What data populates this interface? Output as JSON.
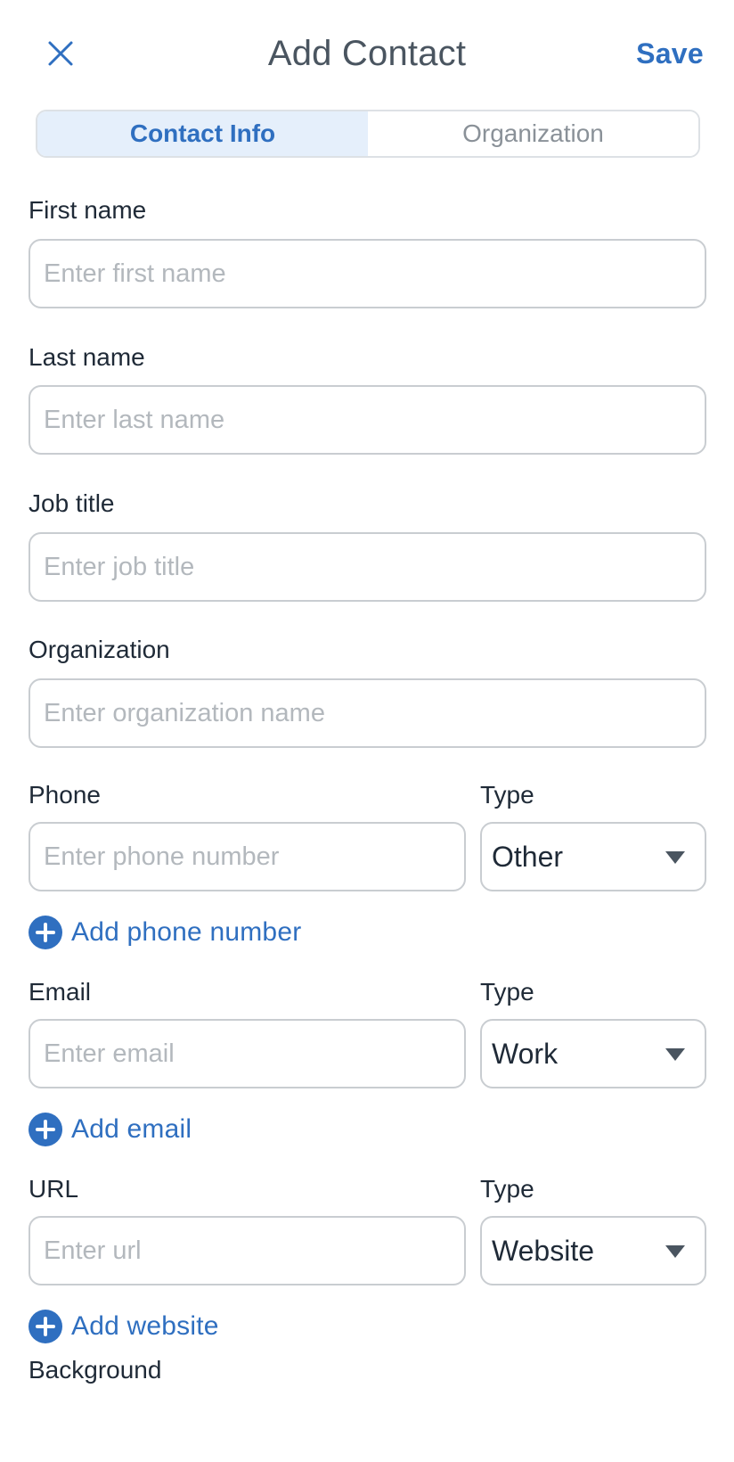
{
  "header": {
    "title": "Add Contact",
    "save_label": "Save"
  },
  "tabs": [
    {
      "label": "Contact Info",
      "active": true
    },
    {
      "label": "Organization",
      "active": false
    }
  ],
  "fields": {
    "first_name": {
      "label": "First name",
      "value": "",
      "placeholder": "Enter first name"
    },
    "last_name": {
      "label": "Last name",
      "value": "",
      "placeholder": "Enter last name"
    },
    "job_title": {
      "label": "Job title",
      "value": "",
      "placeholder": "Enter job title"
    },
    "organization": {
      "label": "Organization",
      "value": "",
      "placeholder": "Enter organization name"
    },
    "phone": {
      "label": "Phone",
      "value": "",
      "placeholder": "Enter phone number",
      "type_label": "Type",
      "type_value": "Other",
      "add_label": "Add phone number"
    },
    "email": {
      "label": "Email",
      "value": "",
      "placeholder": "Enter email",
      "type_label": "Type",
      "type_value": "Work",
      "add_label": "Add email"
    },
    "url": {
      "label": "URL",
      "value": "",
      "placeholder": "Enter url",
      "type_label": "Type",
      "type_value": "Website",
      "add_label": "Add website"
    },
    "background": {
      "label": "Background"
    }
  },
  "colors": {
    "accent": "#2f6fc0",
    "active_tab_bg": "#e5effb",
    "border": "#c9cdd1",
    "placeholder": "#b3b8bd",
    "text": "#1f2a37"
  },
  "icons": {
    "close": "close-icon",
    "add": "plus-circle-icon",
    "dropdown": "chevron-down-icon"
  }
}
